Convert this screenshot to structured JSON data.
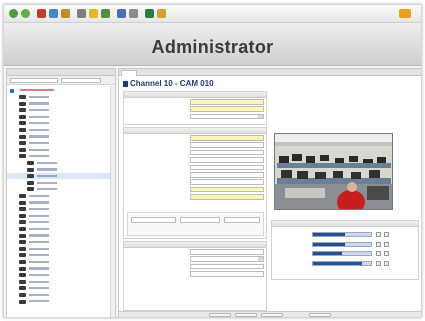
{
  "app": {
    "title": "Administrator"
  },
  "tree": {
    "header": "",
    "rows": 33
  },
  "tabs": [
    "",
    "",
    "",
    "",
    "",
    ""
  ],
  "main": {
    "channel_title": "Channel 10 - CAM 010"
  },
  "sections": {
    "basic": "",
    "stream": "",
    "preview": "",
    "adjust": "",
    "other": ""
  },
  "colors": {
    "accent": "#1f3d74",
    "tree_root": "#b4141c",
    "highlight_field": "#fbf6b4",
    "slider_fill": "#274f93"
  },
  "sliders": [
    {
      "value": 0.55
    },
    {
      "value": 0.55
    },
    {
      "value": 0.5
    },
    {
      "value": 0.85
    }
  ],
  "icons": {
    "toolbar": [
      "back-icon",
      "forward-icon",
      "stop-icon",
      "refresh-icon",
      "home-icon",
      "search-icon",
      "favorites-icon",
      "history-icon",
      "mail-icon",
      "print-icon",
      "edit-icon",
      "settings-icon"
    ],
    "right": "windows-logo-icon"
  }
}
